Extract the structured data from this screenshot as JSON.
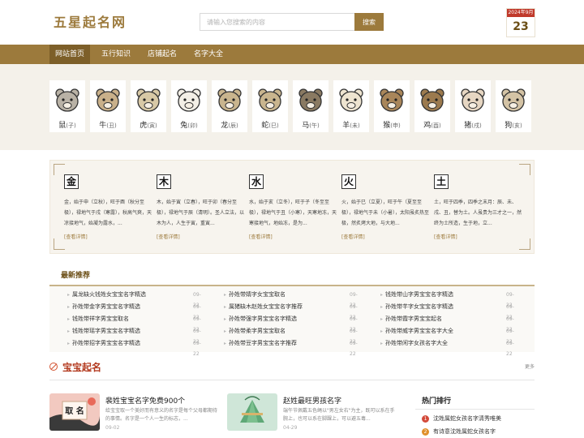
{
  "header": {
    "logo": "五星起名网",
    "search_placeholder": "请输入您搜索的内容",
    "search_button": "搜索",
    "calendar_month": "2024年9月",
    "calendar_day": "23"
  },
  "nav": {
    "items": [
      {
        "label": "网站首页",
        "active": true
      },
      {
        "label": "五行知识",
        "active": false
      },
      {
        "label": "店铺起名",
        "active": false
      },
      {
        "label": "名字大全",
        "active": false
      }
    ]
  },
  "zodiac": [
    {
      "name": "鼠",
      "branch": "(子)",
      "icon": "rat-icon"
    },
    {
      "name": "牛",
      "branch": "(丑)",
      "icon": "ox-icon"
    },
    {
      "name": "虎",
      "branch": "(寅)",
      "icon": "tiger-icon"
    },
    {
      "name": "兔",
      "branch": "(卯)",
      "icon": "rabbit-icon"
    },
    {
      "name": "龙",
      "branch": "(辰)",
      "icon": "dragon-icon"
    },
    {
      "name": "蛇",
      "branch": "(巳)",
      "icon": "snake-icon"
    },
    {
      "name": "马",
      "branch": "(午)",
      "icon": "horse-icon"
    },
    {
      "name": "羊",
      "branch": "(未)",
      "icon": "goat-icon"
    },
    {
      "name": "猴",
      "branch": "(申)",
      "icon": "monkey-icon"
    },
    {
      "name": "鸡",
      "branch": "(酉)",
      "icon": "rooster-icon"
    },
    {
      "name": "猪",
      "branch": "(戌)",
      "icon": "pig-icon"
    },
    {
      "name": "狗",
      "branch": "(亥)",
      "icon": "dog-icon"
    }
  ],
  "wuxing": [
    {
      "char": "金",
      "text": "金，始于申（立秋），旺于酉（秋分至极），禄地气于戌（寒露），秋高气爽，天凉接地气，始凝为露水，...",
      "more": "[查看详情]"
    },
    {
      "char": "木",
      "text": "木，始于寅（立春），旺于卯（春分至极），禄地气于辰（清明）。圣人立法，以木为人，人生于寅，重寅...",
      "more": "[查看详情]"
    },
    {
      "char": "水",
      "text": "水，始于亥（立冬），旺于子（冬至至极），禄地气于丑（小寒），天寒地冻，天寒接地气，地始冻，是为...",
      "more": "[查看详情]"
    },
    {
      "char": "火",
      "text": "火，始于巳（立夏），旺于午（夏至至极），禄地气于未（小暑），太阳虽炙热至极，然炙烤大地，与大地...",
      "more": "[查看详情]"
    },
    {
      "char": "土",
      "text": "土，旺于四季，四季之末月：辰、未、戌、丑，替为土。人虽贵为三才之一，然终为土所造，生于地，立...",
      "more": "[查看详情]"
    }
  ],
  "latest": {
    "title": "最新推荐",
    "columns": [
      [
        {
          "text": "属龙缺火钱姓女宝宝名字精选",
          "date": "09-22"
        },
        {
          "text": "孙姓带金字男宝宝名字精选",
          "date": "09-22"
        },
        {
          "text": "钱姓带祥字男宝宝取名",
          "date": "09-22"
        },
        {
          "text": "钱姓带瑶字男宝宝名字精选",
          "date": "09-22"
        },
        {
          "text": "孙姓带招字男宝宝名字精选",
          "date": "09-22"
        }
      ],
      [
        {
          "text": "孙姓带婧字女宝宝取名",
          "date": "09-22"
        },
        {
          "text": "属猪缺木赵姓女宝宝名字推荐",
          "date": "09-22"
        },
        {
          "text": "孙姓带强字男宝宝名字精选",
          "date": "09-22"
        },
        {
          "text": "孙姓带柔字男宝宝取名",
          "date": "09-22"
        },
        {
          "text": "孙姓带豆字男宝宝名字推荐",
          "date": "09-22"
        }
      ],
      [
        {
          "text": "钱姓带山字男宝宝名字精选",
          "date": "09-22"
        },
        {
          "text": "孙姓带芊字女宝宝名字精选",
          "date": "09-22"
        },
        {
          "text": "孙姓带霞字男宝宝起名",
          "date": "09-22"
        },
        {
          "text": "孙姓带威字男宝宝名字大全",
          "date": "09-22"
        },
        {
          "text": "孙姓带闲字女孩名字大全",
          "date": "09-22"
        }
      ]
    ]
  },
  "baby": {
    "title": "宝宝起名",
    "more": "更多",
    "articles": [
      {
        "title": "裴姓宝宝名字免费900个",
        "desc": "给宝宝取一个美好而有意义的名字是每个父母都期待的事情。名字是一个人一生的标志，...",
        "date": "09-02",
        "img_label": "取 名"
      },
      {
        "title": "赵姓最旺男孩名字",
        "desc": "端午节佩戴五色绳以\"男左女右\"为主，既可以系在手腕上，也可以系在脚踝上，可以避五毒...",
        "date": "04-29"
      }
    ]
  },
  "hot": {
    "title": "热门排行",
    "items": [
      {
        "num": "1",
        "text": "沈姓属蛇女孩名字清秀唯美",
        "color": "#d34a3a"
      },
      {
        "num": "2",
        "text": "有诗意沈姓属蛇女孩名字",
        "color": "#e0902a"
      }
    ]
  }
}
